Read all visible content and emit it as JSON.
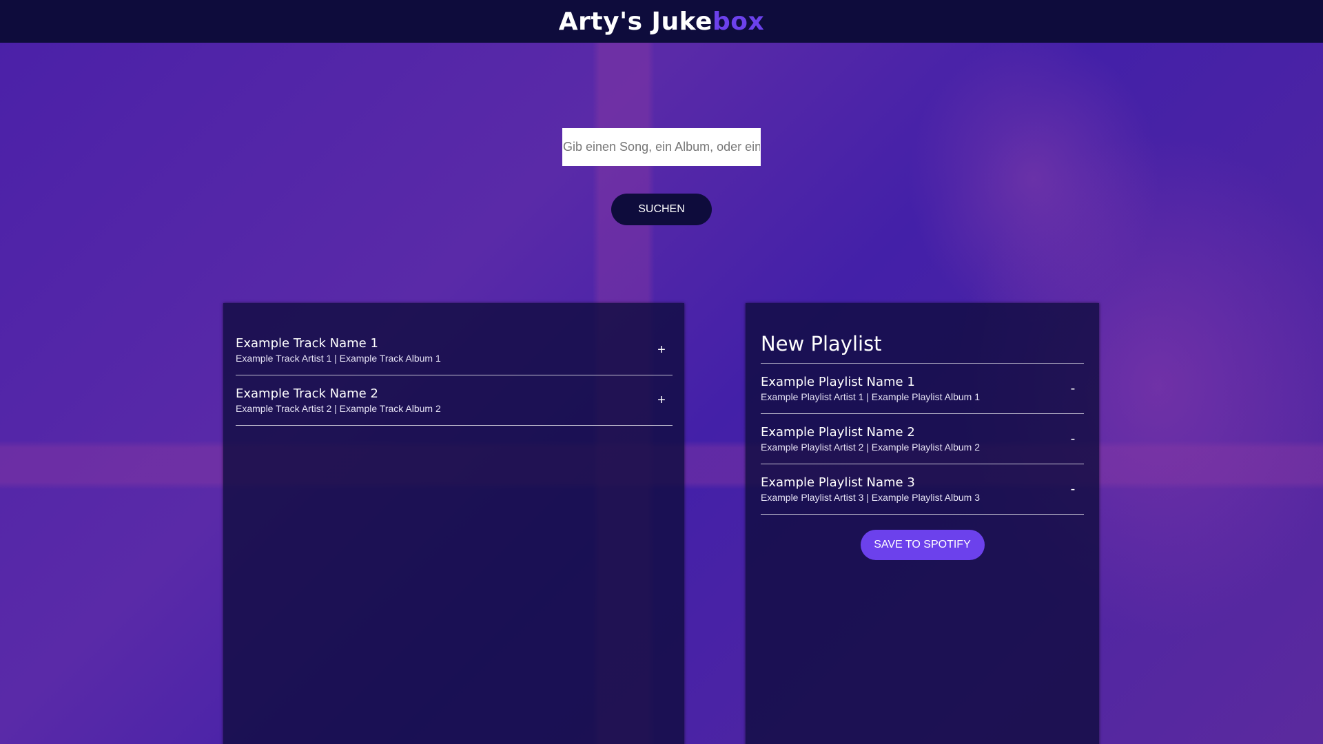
{
  "header": {
    "title_main": "Arty's Juke",
    "title_accent": "box"
  },
  "search": {
    "placeholder": "Gib einen Song, ein Album, oder ein",
    "button_label": "SUCHEN"
  },
  "results": {
    "tracks": [
      {
        "name": "Example Track Name 1",
        "meta": "Example Track Artist 1 | Example Track Album 1",
        "action": "+"
      },
      {
        "name": "Example Track Name 2",
        "meta": "Example Track Artist 2 | Example Track Album 2",
        "action": "+"
      }
    ]
  },
  "playlist": {
    "title": "New Playlist",
    "tracks": [
      {
        "name": "Example Playlist Name 1",
        "meta": "Example Playlist Artist 1 | Example Playlist Album 1",
        "action": "-"
      },
      {
        "name": "Example Playlist Name 2",
        "meta": "Example Playlist Artist 2 | Example Playlist Album 2",
        "action": "-"
      },
      {
        "name": "Example Playlist Name 3",
        "meta": "Example Playlist Artist 3 | Example Playlist Album 3",
        "action": "-"
      }
    ],
    "save_label": "SAVE TO SPOTIFY"
  },
  "colors": {
    "header_bg": "#0e0c3c",
    "accent": "#6c41ec",
    "panel_bg": "#0e0c3c"
  }
}
